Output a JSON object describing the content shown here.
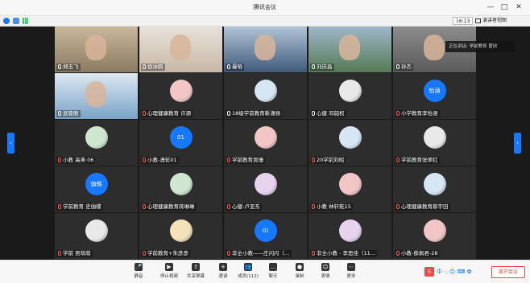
{
  "window": {
    "title": "腾讯会议",
    "minimize": "—",
    "maximize": "□",
    "close": "✕"
  },
  "toolbar": {
    "time": "16:13",
    "view_label": "演讲者视图"
  },
  "speaker_badge": "正在讲话: 学前教育 翟欣",
  "colors": {
    "accent": "#1677ff",
    "danger": "#e94a4a"
  },
  "participants": [
    {
      "name": "郑玉飞",
      "muted": false,
      "kind": "video"
    },
    {
      "name": "徐冰鸥",
      "muted": false,
      "kind": "video",
      "host": true
    },
    {
      "name": "曼哈",
      "muted": false,
      "kind": "video"
    },
    {
      "name": "刘庆昌",
      "muted": false,
      "kind": "video"
    },
    {
      "name": "孙杰",
      "muted": false,
      "kind": "video"
    },
    {
      "name": "武晋丽",
      "muted": false,
      "kind": "video"
    },
    {
      "name": "心理健康教育 许源",
      "muted": true,
      "kind": "avatar"
    },
    {
      "name": "18级学前教育靳潇扬",
      "muted": false,
      "kind": "avatar"
    },
    {
      "name": "心健 邓韶权",
      "muted": false,
      "kind": "avatar"
    },
    {
      "name": "小学教育李怡涵",
      "muted": true,
      "kind": "text",
      "avatar_text": "怡涵"
    },
    {
      "name": "小教 高燕 06",
      "muted": true,
      "kind": "avatar"
    },
    {
      "name": "小教-潇彩01",
      "muted": true,
      "kind": "text",
      "avatar_text": "01"
    },
    {
      "name": "学前教育贾珊",
      "muted": true,
      "kind": "avatar"
    },
    {
      "name": "20学前刘昭",
      "muted": true,
      "kind": "avatar"
    },
    {
      "name": "学前教育张翠红",
      "muted": true,
      "kind": "avatar"
    },
    {
      "name": "学前教育 史伽蝶",
      "muted": true,
      "kind": "text",
      "avatar_text": "伽蝶"
    },
    {
      "name": "心理健康教育蒋琳琳",
      "muted": true,
      "kind": "avatar"
    },
    {
      "name": "心健-卢亚东",
      "muted": true,
      "kind": "avatar"
    },
    {
      "name": "小教 林轩乾15",
      "muted": true,
      "kind": "avatar"
    },
    {
      "name": "心理健康教育蔡宇田",
      "muted": true,
      "kind": "avatar"
    },
    {
      "name": "学前 贾萌萌",
      "muted": true,
      "kind": "avatar"
    },
    {
      "name": "学前教育+朱彦彦",
      "muted": true,
      "kind": "avatar"
    },
    {
      "name": "非全小教——庄闪闪（…",
      "muted": true,
      "kind": "text",
      "avatar_text": "0)"
    },
    {
      "name": "非全小教 - 李思佳（11…",
      "muted": true,
      "kind": "avatar"
    },
    {
      "name": "小教-薛佩君-28",
      "muted": true,
      "kind": "avatar"
    }
  ],
  "controls": [
    {
      "label": "静音",
      "icon": "mic-icon"
    },
    {
      "label": "停止视频",
      "icon": "camera-icon"
    },
    {
      "label": "共享屏幕",
      "icon": "share-screen-icon"
    },
    {
      "label": "邀请",
      "icon": "invite-icon"
    },
    {
      "label": "成员(112)",
      "icon": "members-icon"
    },
    {
      "label": "聊天",
      "icon": "chat-icon"
    },
    {
      "label": "录制",
      "icon": "record-icon"
    },
    {
      "label": "表情",
      "icon": "emoji-icon"
    },
    {
      "label": "更多",
      "icon": "more-icon"
    }
  ],
  "leave_label": "离开会议",
  "ime_label": "中"
}
